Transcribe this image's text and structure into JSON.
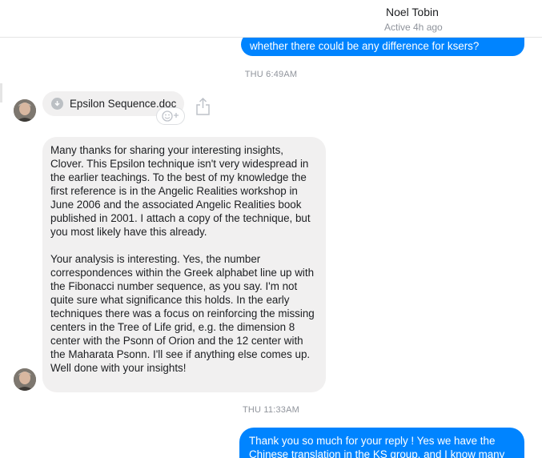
{
  "header": {
    "contact_name": "Noel Tobin",
    "status": "Active 4h ago"
  },
  "messages": {
    "outgoing_top": "whether there could be any difference for ksers?",
    "timestamp_1": "THU 6:49AM",
    "attachment": {
      "file_name": "Epsilon Sequence.doc",
      "icon": "download-icon"
    },
    "reply_text": "Many thanks for sharing your interesting insights, Clover.  This Epsilon technique isn't very widespread in the earlier teachings.  To the best of my knowledge the first reference is in the Angelic Realities workshop in June 2006 and the associated Angelic Realities book published in 2001.  I attach a copy of the technique, but you most likely have this already.\n\nYour analysis is interesting.  Yes, the number correspondences within the Greek alphabet line up with the Fibonacci number sequence, as you say.  I'm not quite sure what significance this holds.  In the early techniques there was a focus on reinforcing the missing centers in the Tree of Life grid, e.g. the dimension 8 center with the Psonn of Orion and the 12 center with the Maharata Psonn.  I'll see if anything else comes up.  Well done with your insights!",
    "timestamp_2": "THU 11:33AM",
    "outgoing_bottom": "Thank you so much for your reply ! Yes we have the Chinese translation in the KS group, and I know many"
  },
  "colors": {
    "outgoing_bubble": "#0084ff",
    "incoming_bubble": "#f1f0f0",
    "timestamp": "#90949c"
  },
  "icons": [
    "download-icon",
    "share-icon",
    "add-reaction-icon",
    "avatar"
  ]
}
